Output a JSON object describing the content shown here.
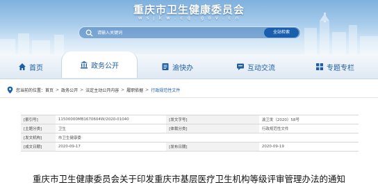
{
  "header": {
    "title": "重庆市卫生健康委员会",
    "domain": "w s j k w . c q . g o v . c n"
  },
  "search": {
    "placeholder": "请输入关键词",
    "button_label": "全站检索"
  },
  "nav": {
    "items": [
      {
        "label": "首页",
        "icon": "home-icon"
      },
      {
        "label": "政务公开",
        "icon": "building-icon",
        "active": true
      },
      {
        "label": "渝快办",
        "icon": "document-icon"
      },
      {
        "label": "互动交流",
        "icon": "chat-icon"
      },
      {
        "label": "专题专栏",
        "icon": "grid-icon"
      }
    ]
  },
  "breadcrumb": {
    "prefix": "您当前的位置：",
    "items": [
      "首页",
      "政务公开",
      "法定主动公开内容",
      "履职依据",
      "行政规范性文件"
    ]
  },
  "info": {
    "rows": [
      {
        "l1": "[索引号]",
        "v1": "11500000MB1670604W/2020-01040",
        "l2": "[发文字号]",
        "v2": "渝卫发（2020）58号"
      },
      {
        "l1": "[主题分类]",
        "v1": "卫生",
        "l2": "[体裁分类]",
        "v2": "行政规范性文件"
      },
      {
        "l1": "[发文机构]",
        "v1": "市卫生健康委",
        "l2": "",
        "v2": ""
      },
      {
        "l1": "[成文日期]",
        "v1": "2020-09-17",
        "l2": "[发布日期]",
        "v2": "2020-09-19"
      }
    ]
  },
  "document": {
    "title": "重庆市卫生健康委员会关于印发重庆市基层医疗卫生机构等级评审管理办法的通知"
  },
  "colors": {
    "brand": "#1a5fae",
    "nav_text": "#1f5ea8",
    "banner_top": "#7fb1de"
  }
}
